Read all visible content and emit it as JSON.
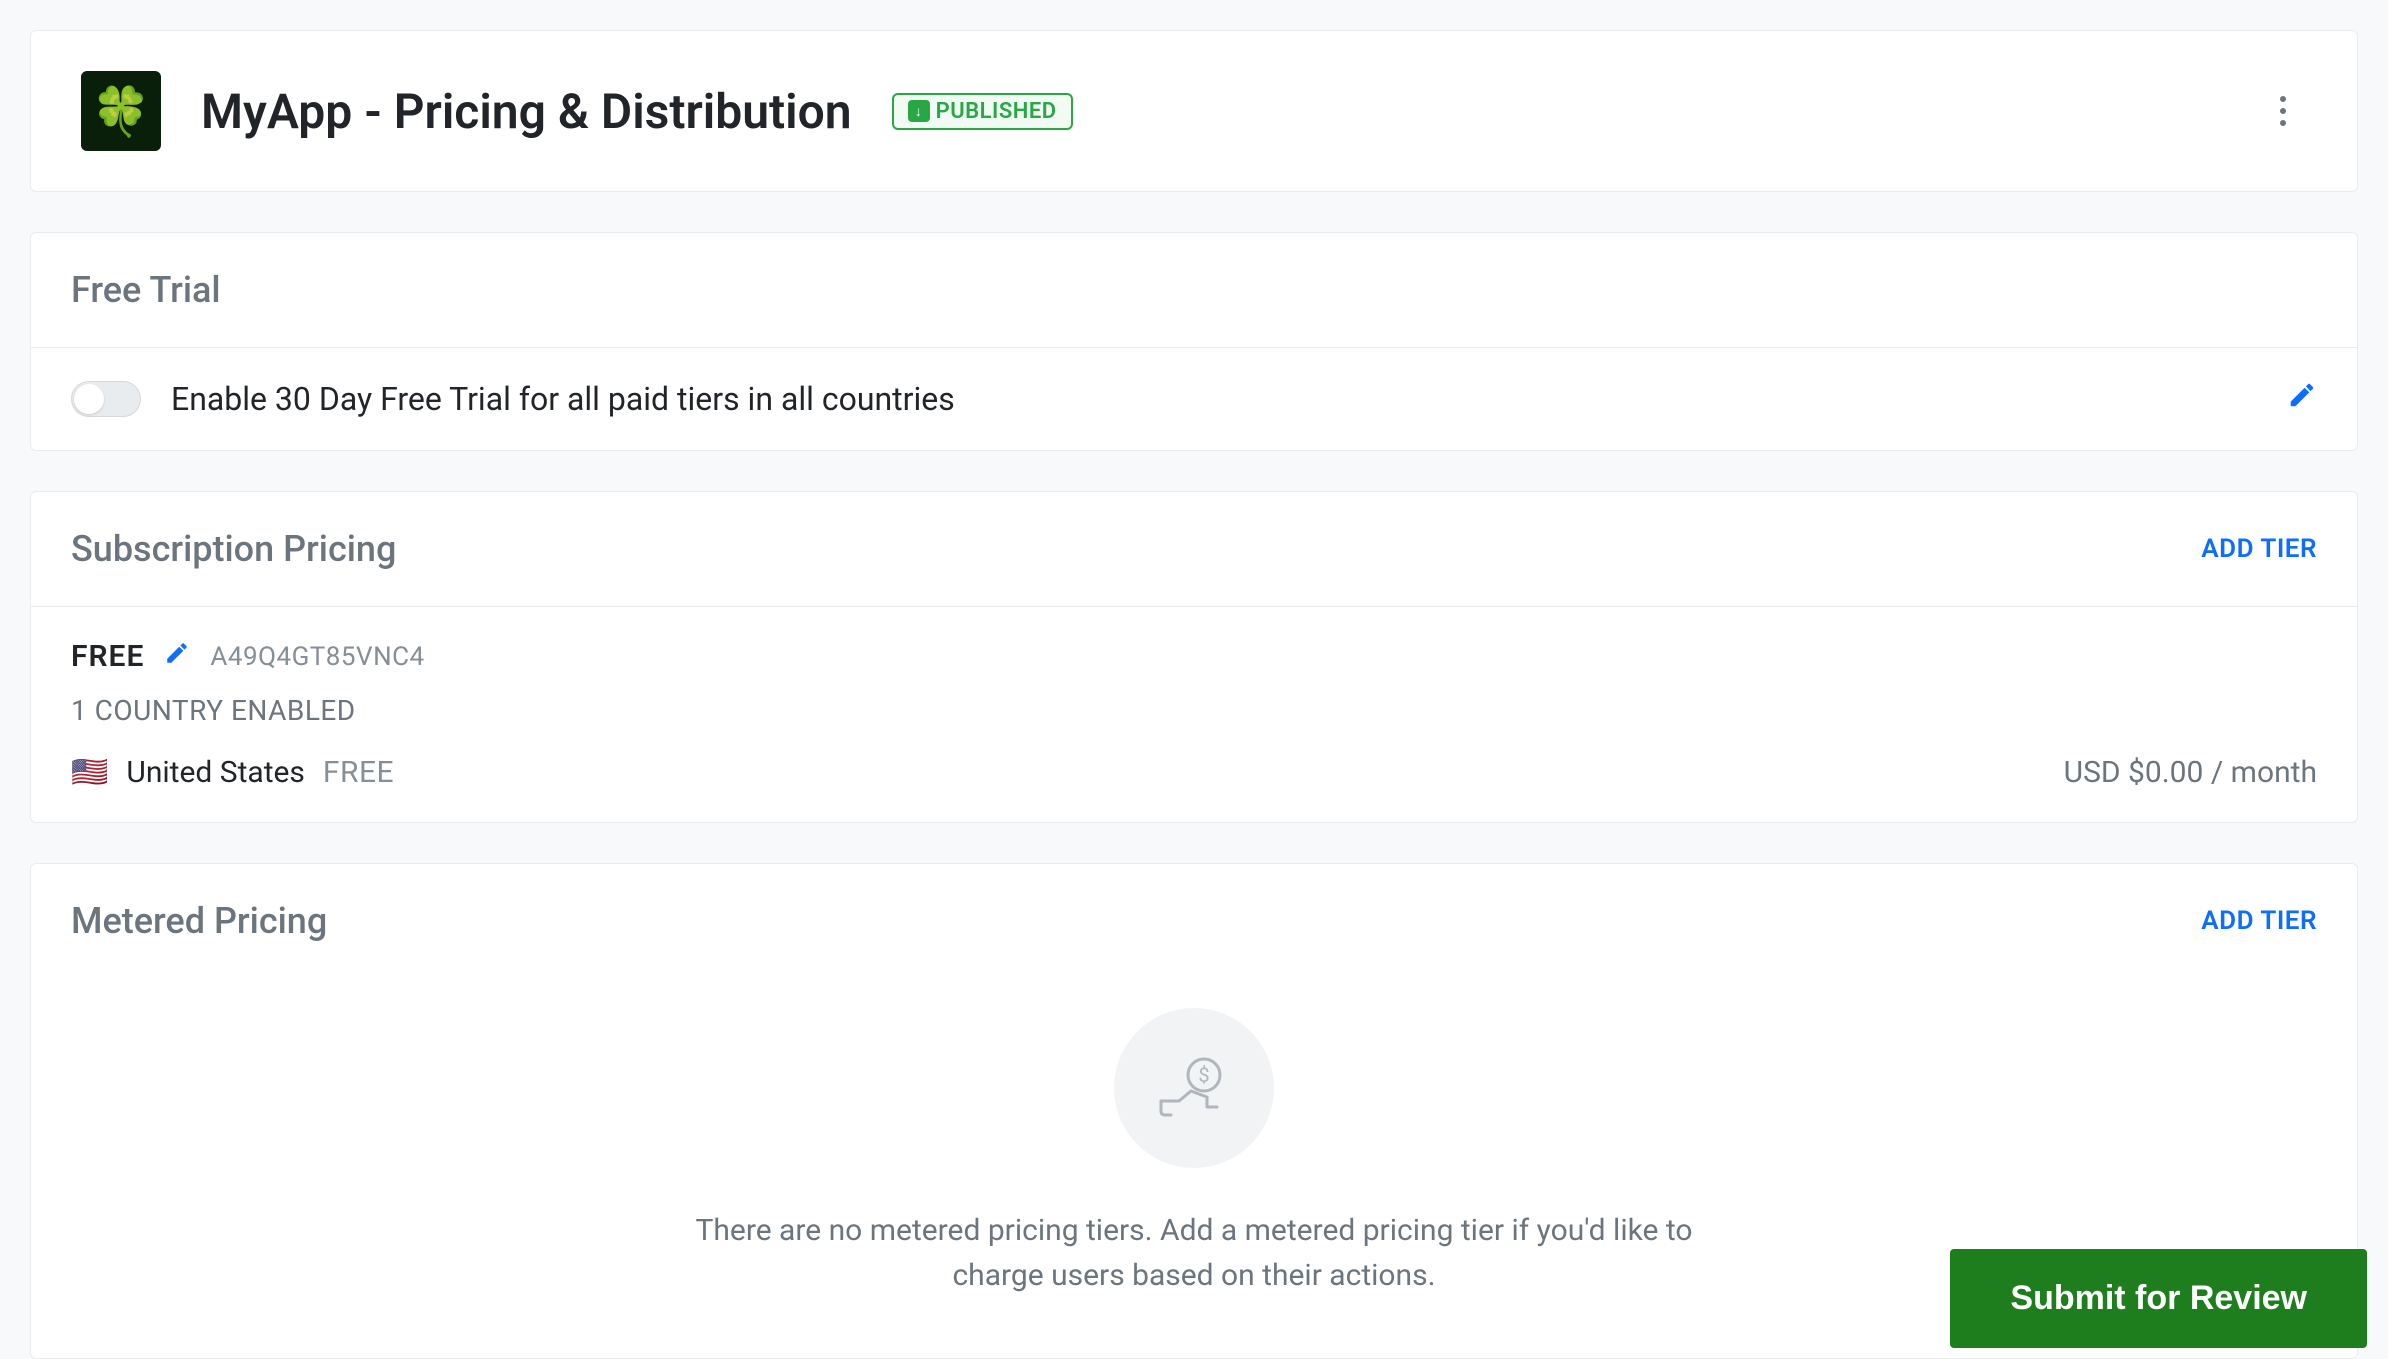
{
  "header": {
    "title": "MyApp - Pricing & Distribution",
    "status": "PUBLISHED",
    "app_icon": "🍀"
  },
  "free_trial": {
    "section_title": "Free Trial",
    "toggle_label": "Enable 30 Day Free Trial for all paid tiers in all countries",
    "enabled": false
  },
  "subscription": {
    "section_title": "Subscription Pricing",
    "add_tier_label": "ADD TIER",
    "tier": {
      "name": "FREE",
      "id": "A49Q4GT85VNC4",
      "countries_enabled_label": "1 COUNTRY ENABLED",
      "country": {
        "flag": "🇺🇸",
        "name": "United States",
        "tier": "FREE",
        "price": "USD $0.00 / month"
      }
    }
  },
  "metered": {
    "section_title": "Metered Pricing",
    "add_tier_label": "ADD TIER",
    "empty_text": "There are no metered pricing tiers. Add a metered pricing tier if you'd like to charge users based on their actions."
  },
  "submit_button": "Submit for Review"
}
